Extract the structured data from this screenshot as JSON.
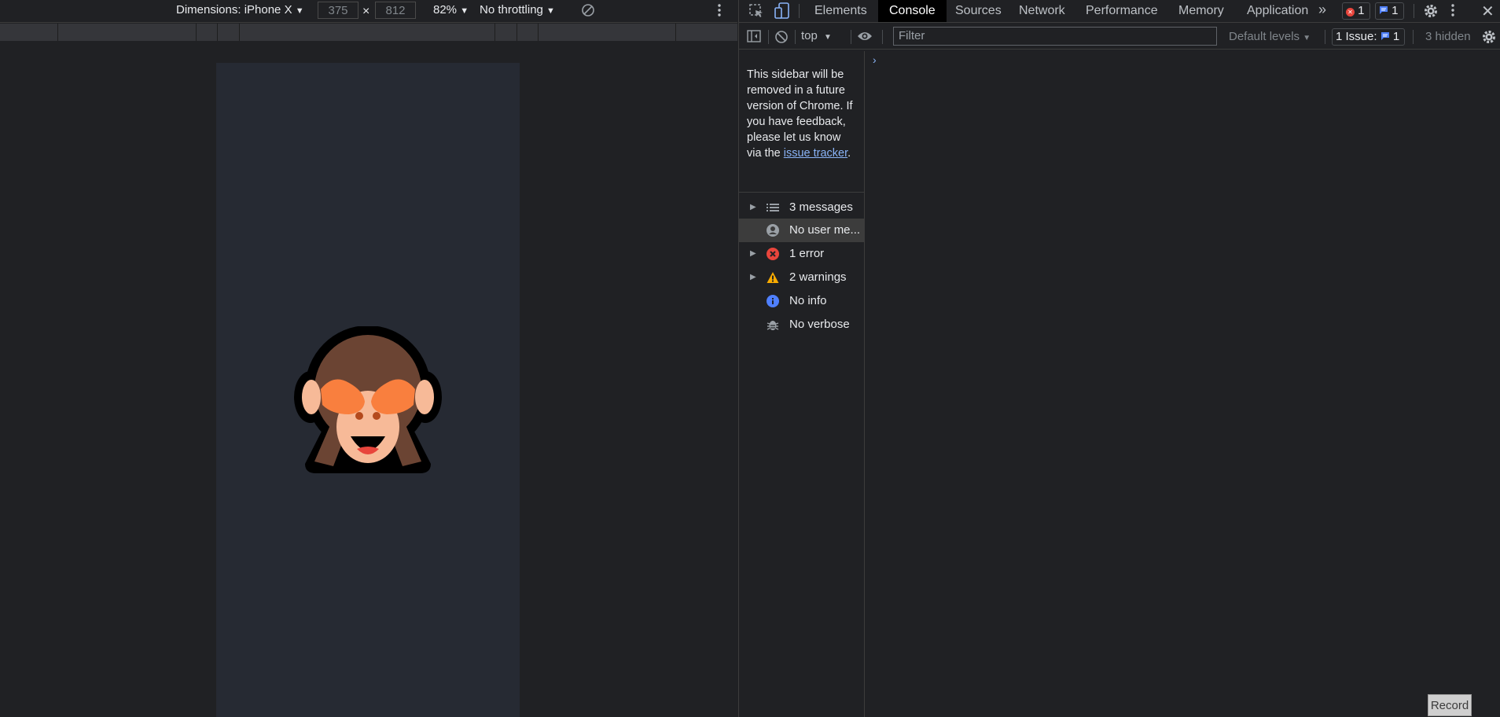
{
  "device_toolbar": {
    "dimensions_label": "Dimensions: iPhone X",
    "width_value": "375",
    "height_value": "812",
    "times": "×",
    "zoom": "82%",
    "throttling": "No throttling"
  },
  "devtools": {
    "tabs": [
      {
        "label": "Elements"
      },
      {
        "label": "Console"
      },
      {
        "label": "Sources"
      },
      {
        "label": "Network"
      },
      {
        "label": "Performance"
      },
      {
        "label": "Memory"
      },
      {
        "label": "Application"
      }
    ],
    "error_count": "1",
    "message_count": "1"
  },
  "console_toolbar": {
    "context": "top",
    "filter_placeholder": "Filter",
    "levels": "Default levels",
    "issues_label": "1 Issue:",
    "issues_count": "1",
    "hidden": "3 hidden"
  },
  "sidebar": {
    "notice_text": "This sidebar will be removed in a future version of Chrome. If you have feedback, please let us know via the ",
    "notice_link": "issue tracker",
    "notice_end": ".",
    "items": [
      {
        "label": "3 messages"
      },
      {
        "label": "No user me..."
      },
      {
        "label": "1 error"
      },
      {
        "label": "2 warnings"
      },
      {
        "label": "No info"
      },
      {
        "label": "No verbose"
      }
    ]
  },
  "console": {
    "prompt": "›"
  },
  "record_label": "Record",
  "colors": {
    "accent_blue": "#8ab4f8",
    "error_red": "#e8453c",
    "warning_yellow": "#f9ab00",
    "info_blue": "#4f80ff",
    "monkey_brown": "#6b4433",
    "monkey_hands": "#f97f3e",
    "monkey_face": "#f7ba98"
  }
}
